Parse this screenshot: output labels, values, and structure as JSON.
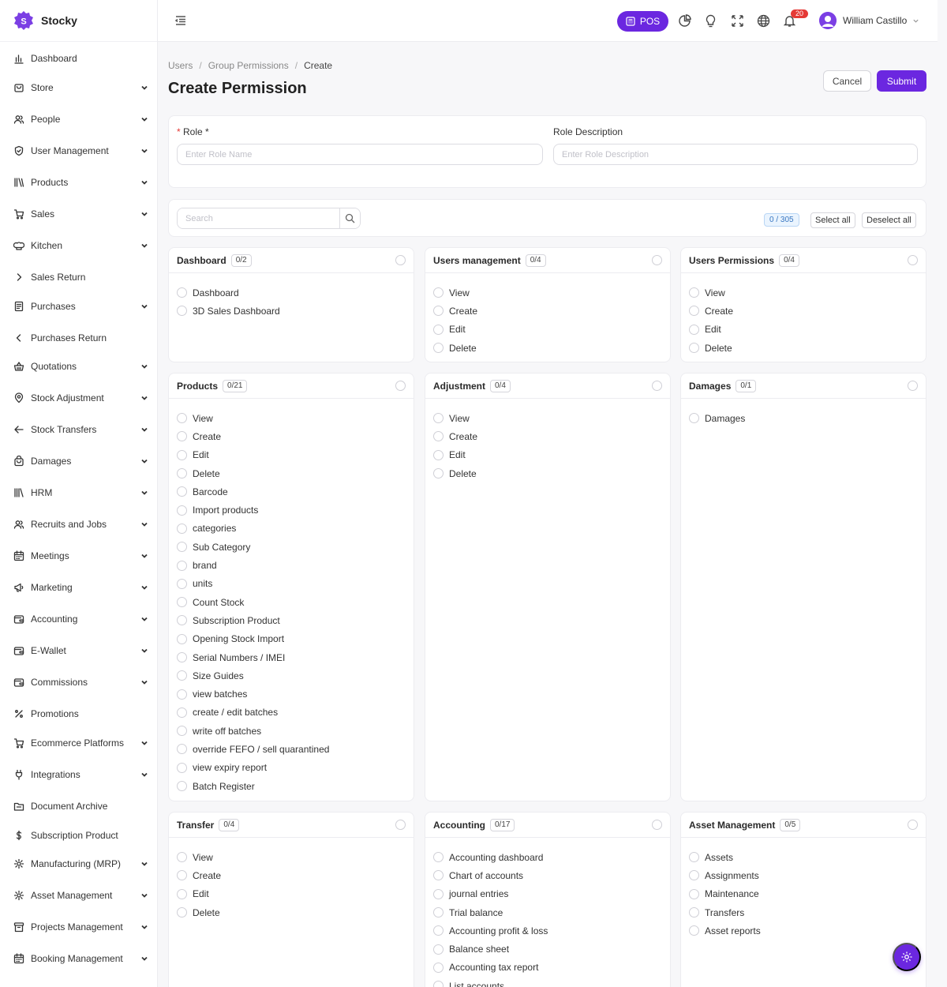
{
  "app": {
    "name": "Stocky"
  },
  "sidebar": {
    "items": [
      {
        "label": "Dashboard",
        "icon": "bar-chart-icon",
        "chevron": "none"
      },
      {
        "label": "Store",
        "icon": "shop-icon",
        "chevron": "down"
      },
      {
        "label": "People",
        "icon": "users-icon",
        "chevron": "down"
      },
      {
        "label": "User Management",
        "icon": "shield-icon",
        "chevron": "down"
      },
      {
        "label": "Products",
        "icon": "books-icon",
        "chevron": "down"
      },
      {
        "label": "Sales",
        "icon": "cart-icon",
        "chevron": "down"
      },
      {
        "label": "Kitchen",
        "icon": "chef-hat-icon",
        "chevron": "down"
      },
      {
        "label": "Sales Return",
        "icon": "chevron-right-icon",
        "chevron": "none"
      },
      {
        "label": "Purchases",
        "icon": "receipt-icon",
        "chevron": "down"
      },
      {
        "label": "Purchases Return",
        "icon": "chevron-left-icon",
        "chevron": "none"
      },
      {
        "label": "Quotations",
        "icon": "basket-icon",
        "chevron": "down"
      },
      {
        "label": "Stock Adjustment",
        "icon": "location-pin-icon",
        "chevron": "down"
      },
      {
        "label": "Stock Transfers",
        "icon": "arrow-left-icon",
        "chevron": "down"
      },
      {
        "label": "Damages",
        "icon": "bag-icon",
        "chevron": "down"
      },
      {
        "label": "HRM",
        "icon": "library-icon",
        "chevron": "down"
      },
      {
        "label": "Recruits and Jobs",
        "icon": "users-icon",
        "chevron": "down"
      },
      {
        "label": "Meetings",
        "icon": "calendar-icon",
        "chevron": "down"
      },
      {
        "label": "Marketing",
        "icon": "megaphone-icon",
        "chevron": "down"
      },
      {
        "label": "Accounting",
        "icon": "wallet-icon",
        "chevron": "down"
      },
      {
        "label": "E-Wallet",
        "icon": "wallet-icon",
        "chevron": "down"
      },
      {
        "label": "Commissions",
        "icon": "wallet-icon",
        "chevron": "down"
      },
      {
        "label": "Promotions",
        "icon": "percent-icon",
        "chevron": "none"
      },
      {
        "label": "Ecommerce Platforms",
        "icon": "cart-icon",
        "chevron": "down"
      },
      {
        "label": "Integrations",
        "icon": "plug-icon",
        "chevron": "down"
      },
      {
        "label": "Document Archive",
        "icon": "folder-icon",
        "chevron": "none"
      },
      {
        "label": "Subscription Product",
        "icon": "dollar-icon",
        "chevron": "none"
      },
      {
        "label": "Manufacturing (MRP)",
        "icon": "gear-icon",
        "chevron": "down"
      },
      {
        "label": "Asset Management",
        "icon": "gear-icon",
        "chevron": "down"
      },
      {
        "label": "Projects Management",
        "icon": "archive-icon",
        "chevron": "down"
      },
      {
        "label": "Booking Management",
        "icon": "calendar-icon",
        "chevron": "down"
      }
    ]
  },
  "topbar": {
    "pos_label": "POS",
    "notification_count": "20",
    "user_name": "William Castillo",
    "icons": [
      "menu-toggle-icon",
      "pie-chart-icon",
      "lightbulb-icon",
      "fullscreen-icon",
      "globe-icon",
      "bell-icon"
    ]
  },
  "breadcrumb": [
    "Users",
    "Group Permissions",
    "Create"
  ],
  "page": {
    "title": "Create Permission",
    "cancel_label": "Cancel",
    "submit_label": "Submit"
  },
  "form": {
    "role_label": "Role *",
    "role_placeholder": "Enter Role Name",
    "role_value": "",
    "desc_label": "Role Description",
    "desc_placeholder": "Enter Role Description",
    "desc_value": ""
  },
  "toolbar": {
    "search_placeholder": "Search",
    "selected_count": "0 / 305",
    "select_all_label": "Select all",
    "deselect_all_label": "Deselect all"
  },
  "groups": [
    {
      "title": "Dashboard",
      "count": "0/2",
      "items": [
        "Dashboard",
        "3D Sales Dashboard"
      ]
    },
    {
      "title": "Users management",
      "count": "0/4",
      "items": [
        "View",
        "Create",
        "Edit",
        "Delete"
      ]
    },
    {
      "title": "Users Permissions",
      "count": "0/4",
      "items": [
        "View",
        "Create",
        "Edit",
        "Delete"
      ]
    },
    {
      "title": "Products",
      "count": "0/21",
      "items": [
        "View",
        "Create",
        "Edit",
        "Delete",
        "Barcode",
        "Import products",
        "categories",
        "Sub Category",
        "brand",
        "units",
        "Count Stock",
        "Subscription Product",
        "Opening Stock Import",
        "Serial Numbers / IMEI",
        "Size Guides",
        "view batches",
        "create / edit batches",
        "write off batches",
        "override FEFO / sell quarantined",
        "view expiry report",
        "Batch Register"
      ]
    },
    {
      "title": "Adjustment",
      "count": "0/4",
      "items": [
        "View",
        "Create",
        "Edit",
        "Delete"
      ]
    },
    {
      "title": "Damages",
      "count": "0/1",
      "items": [
        "Damages"
      ]
    },
    {
      "title": "Transfer",
      "count": "0/4",
      "items": [
        "View",
        "Create",
        "Edit",
        "Delete"
      ]
    },
    {
      "title": "Accounting",
      "count": "0/17",
      "items": [
        "Accounting dashboard",
        "Chart of accounts",
        "journal entries",
        "Trial balance",
        "Accounting profit & loss",
        "Balance sheet",
        "Accounting tax report",
        "List accounts"
      ]
    },
    {
      "title": "Asset Management",
      "count": "0/5",
      "items": [
        "Assets",
        "Assignments",
        "Maintenance",
        "Transfers",
        "Asset reports"
      ]
    }
  ]
}
